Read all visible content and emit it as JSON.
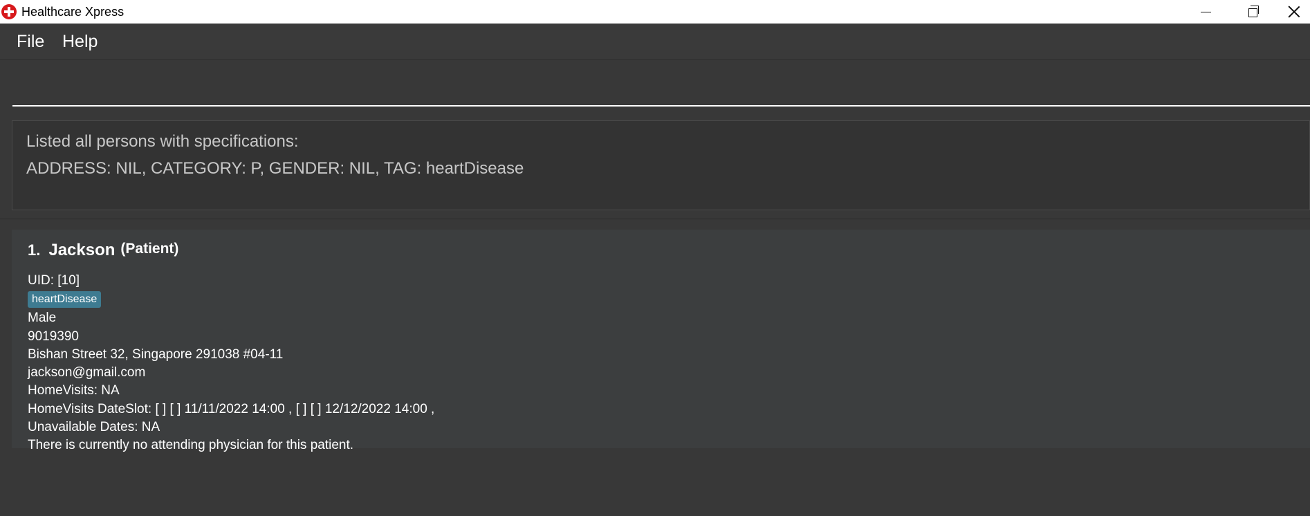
{
  "window": {
    "title": "Healthcare Xpress",
    "icon": "red-cross-icon",
    "controls": [
      "minimize-icon",
      "restore-icon",
      "close-icon"
    ]
  },
  "menu": {
    "file": "File",
    "help": "Help"
  },
  "command": {
    "value": "",
    "placeholder": ""
  },
  "result": {
    "line1": "Listed all persons with specifications:",
    "line2": "ADDRESS: NIL, CATEGORY: P, GENDER: NIL, TAG: heartDisease"
  },
  "persons": [
    {
      "index": "1.",
      "name": "Jackson",
      "category": "(Patient)",
      "uid": "UID: [10]",
      "tags": [
        "heartDisease"
      ],
      "gender": "Male",
      "phone": "9019390",
      "address": "Bishan Street 32, Singapore 291038 #04-11",
      "email": "jackson@gmail.com",
      "home_visits": "HomeVisits: NA",
      "date_slot": "HomeVisits DateSlot: [ ] [ ] 11/11/2022 14:00 , [ ] [ ] 12/12/2022 14:00 ,",
      "unavailable_dates": "Unavailable Dates: NA",
      "physician": "There is currently no attending physician for this patient."
    }
  ],
  "colors": {
    "background": "#383838",
    "tag": "#3e7b91",
    "card": "#3c3e3f"
  }
}
